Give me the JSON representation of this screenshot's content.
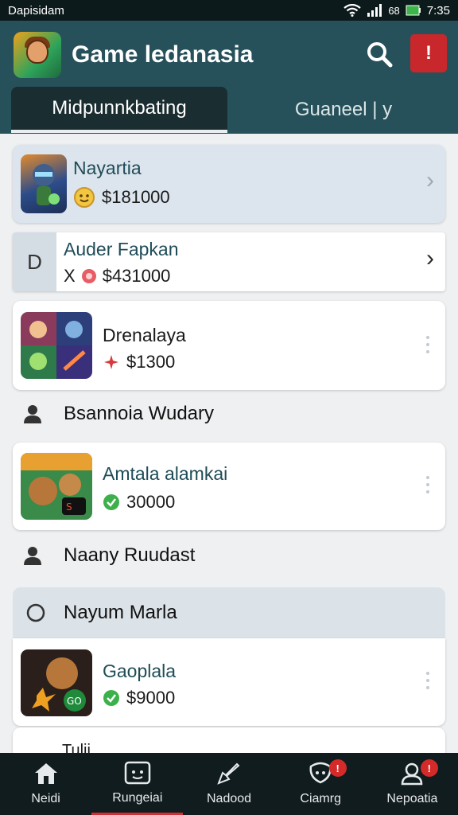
{
  "status_bar": {
    "left_text": "Dapisidam",
    "battery_label": "68",
    "time": "7:35"
  },
  "app_bar": {
    "title": "Game ledanasia",
    "alert_label": "!",
    "colors": {
      "bar": "#27515a",
      "alert": "#c8282b"
    }
  },
  "tabs": [
    {
      "label": "Midpunnkbating",
      "active": true
    },
    {
      "label": "Guaneel | y",
      "active": false
    }
  ],
  "items": [
    {
      "title": "Nayartia",
      "price": "$181000",
      "price_icon": "coin-icon"
    },
    {
      "title": "Auder Fapkan",
      "avatar_letter": "D",
      "prefix": "X",
      "price": "$431000",
      "price_icon": "red-disc-icon"
    },
    {
      "title": "Drenalaya",
      "price": "$1300",
      "price_icon": "red-star-icon"
    },
    {
      "title": "Amtala alamkai",
      "price": "30000",
      "price_icon": "check-icon"
    },
    {
      "title": "Gaoplala",
      "price": "$9000",
      "price_icon": "check-icon"
    },
    {
      "title": "Tulii"
    }
  ],
  "sections": [
    {
      "label": "Bsannoia Wudary",
      "icon": "person-icon"
    },
    {
      "label": "Naany Ruudast",
      "icon": "person-icon"
    },
    {
      "label": "Nayum Marla",
      "icon": "circle-icon"
    }
  ],
  "bottom_nav": [
    {
      "label": "Neidi",
      "icon": "home-icon",
      "badge": ""
    },
    {
      "label": "Rungeiai",
      "icon": "gamepad-icon",
      "badge": ""
    },
    {
      "label": "Nadood",
      "icon": "rocket-icon",
      "badge": ""
    },
    {
      "label": "Ciamrg",
      "icon": "chat-icon",
      "badge": "!"
    },
    {
      "label": "Nepoatia",
      "icon": "profile-icon",
      "badge": "!"
    }
  ]
}
